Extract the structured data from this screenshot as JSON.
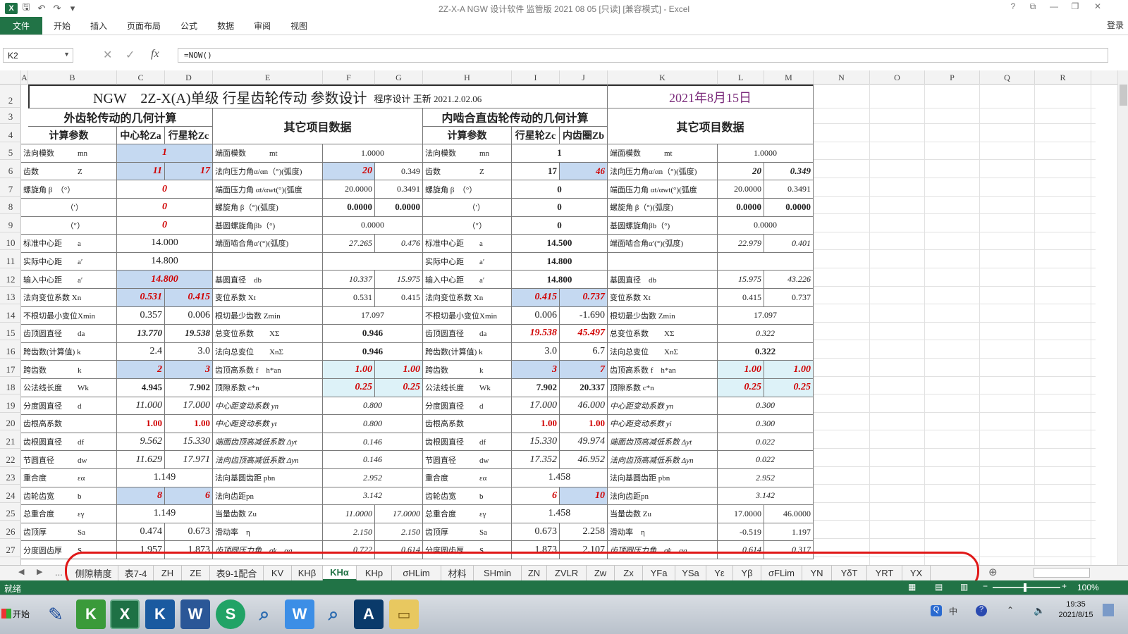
{
  "window": {
    "title": "2Z-X-A NGW 设计软件 监管版 2021 08 05 [只读] [兼容模式] - Excel",
    "help": "?",
    "restore": "⧉",
    "minimize": "—",
    "maximize": "❐",
    "close": "✕"
  },
  "quick_access": {
    "save": "🖫",
    "undo": "↶",
    "redo": "↷",
    "more": "▾"
  },
  "ribbon": {
    "tabs": [
      "文件",
      "开始",
      "插入",
      "页面布局",
      "公式",
      "数据",
      "审阅",
      "视图"
    ],
    "login": "登录"
  },
  "formula_bar": {
    "name_box": "K2",
    "cancel": "✕",
    "enter": "✓",
    "fx": "fx",
    "formula": "=NOW()"
  },
  "columns": [
    "A",
    "B",
    "C",
    "D",
    "E",
    "F",
    "G",
    "H",
    "I",
    "J",
    "K",
    "L",
    "M",
    "N",
    "O",
    "P",
    "Q",
    "R"
  ],
  "rows": [
    "2",
    "3",
    "4",
    "5",
    "6",
    "7",
    "8",
    "9",
    "10",
    "11",
    "12",
    "13",
    "14",
    "15",
    "16",
    "17",
    "18",
    "19",
    "20",
    "21",
    "22",
    "23",
    "24",
    "25",
    "26",
    "27"
  ],
  "sheet": {
    "title": "NGW　2Z-X(A)单级 行星齿轮传动 参数设计",
    "designer": "程序设计 王新 2021.2.02.06",
    "date": "2021年8月15日",
    "left_header": "外齿轮传动的几何计算",
    "mid_header_1": "其它项目数据",
    "right_header": "内啮合直齿轮传动的几何计算",
    "mid_header_2": "其它项目数据",
    "sub": {
      "param": "计算参数",
      "sun": "中心轮Za",
      "planet": "行星轮Zc",
      "param2": "计算参数",
      "planet2": "行星轮Zc",
      "ring": "内齿圈Zb"
    },
    "left_rows": [
      [
        "法向模数　　　mn",
        "1",
        ""
      ],
      [
        "齿数　　　　　Z",
        "11",
        "17"
      ],
      [
        "螺旋角 β　（°）",
        "0",
        ""
      ],
      [
        "　　　　　　（′）",
        "0",
        ""
      ],
      [
        "　　　　　　（″）",
        "0",
        ""
      ],
      [
        "标准中心距　　a",
        "14.000",
        ""
      ],
      [
        "实际中心距　　a′",
        "14.800",
        ""
      ],
      [
        "输入中心距　　a′",
        "14.800",
        ""
      ],
      [
        "法向变位系数 Xn",
        "0.531",
        "0.415"
      ],
      [
        "不根切最小变位Xmin",
        "0.357",
        "0.006"
      ],
      [
        "齿顶圆直径　　da",
        "13.770",
        "19.538"
      ],
      [
        "跨齿数(计算值) k",
        "2.4",
        "3.0"
      ],
      [
        "跨齿数　　　　k",
        "2",
        "3"
      ],
      [
        "公法线长度　　Wk",
        "4.945",
        "7.902"
      ],
      [
        "分度圆直径　　d",
        "11.000",
        "17.000"
      ],
      [
        "齿根高系数",
        "1.00",
        "1.00"
      ],
      [
        "齿根圆直径　　df",
        "9.562",
        "15.330"
      ],
      [
        "节圆直径　　　dw",
        "11.629",
        "17.971"
      ],
      [
        "重合度　　　　εα",
        "1.149",
        ""
      ],
      [
        "齿轮齿宽　　　b",
        "8",
        "6"
      ],
      [
        "总重合度　　　εγ",
        "1.149",
        ""
      ],
      [
        "齿顶厚　　　　Sa",
        "0.474",
        "0.673"
      ],
      [
        "分度圆齿厚　　S",
        "1.957",
        "1.873"
      ]
    ],
    "mid_rows_1": [
      [
        "端面模数　　　mt",
        "1.0000",
        ""
      ],
      [
        "法向压力角α/αn（°)(弧度)",
        "20",
        "0.349"
      ],
      [
        "端面压力角 αt/αwt(°)(弧度",
        "20.0000",
        "0.3491"
      ],
      [
        "螺旋角 β（°)(弧度)",
        "0.0000",
        "0.0000"
      ],
      [
        "基圆螺旋角βb（°)",
        "0.0000",
        ""
      ],
      [
        "端面啮合角α′(°)(弧度)",
        "27.265",
        "0.476"
      ],
      [
        "",
        "",
        ""
      ],
      [
        "基圆直径　db",
        "10.337",
        "15.975"
      ],
      [
        "变位系数 Xt",
        "0.531",
        "0.415"
      ],
      [
        "根切最少齿数 Zmin",
        "17.097",
        ""
      ],
      [
        "总变位系数　　XΣ",
        "0.946",
        ""
      ],
      [
        "法向总变位　　XnΣ",
        "0.946",
        ""
      ],
      [
        "齿顶高系数 f　h*an",
        "1.00",
        "1.00"
      ],
      [
        "顶隙系数 c*n",
        "0.25",
        "0.25"
      ],
      [
        "中心距变动系数 yn",
        "0.800",
        ""
      ],
      [
        "中心距变动系数 yt",
        "0.800",
        ""
      ],
      [
        "端面齿顶高减低系数 Δyt",
        "0.146",
        ""
      ],
      [
        "法向齿顶高减低系数 Δyn",
        "0.146",
        ""
      ],
      [
        "法向基圆齿距 pbn",
        "2.952",
        ""
      ],
      [
        "法向齿距pn",
        "3.142",
        ""
      ],
      [
        "当量齿数 Zu",
        "11.0000",
        "17.0000"
      ],
      [
        "滑动率　η",
        "2.150",
        "2.150"
      ],
      [
        "齿顶圆压力角　σk　αa",
        "0.722",
        "0.614"
      ]
    ],
    "right_rows": [
      [
        "法向模数　　　mn",
        "1",
        ""
      ],
      [
        "齿数　　　　　Z",
        "17",
        "46"
      ],
      [
        "螺旋角 β　（°）",
        "0",
        ""
      ],
      [
        "　　　　　　（′）",
        "0",
        ""
      ],
      [
        "　　　　　　（″）",
        "0",
        ""
      ],
      [
        "标准中心距　　a",
        "14.500",
        ""
      ],
      [
        "实际中心距　　a′",
        "14.800",
        ""
      ],
      [
        "输入中心距　　a′",
        "14.800",
        ""
      ],
      [
        "法向变位系数 Xn",
        "0.415",
        "0.737"
      ],
      [
        "不根切最小变位Xmin",
        "0.006",
        "-1.690"
      ],
      [
        "齿顶圆直径　　da",
        "19.538",
        "45.497"
      ],
      [
        "跨齿数(计算值) k",
        "3.0",
        "6.7"
      ],
      [
        "跨齿数　　　　k",
        "3",
        "7"
      ],
      [
        "公法线长度　　Wk",
        "7.902",
        "20.337"
      ],
      [
        "分度圆直径　　d",
        "17.000",
        "46.000"
      ],
      [
        "齿根高系数",
        "1.00",
        "1.00"
      ],
      [
        "齿根圆直径　　df",
        "15.330",
        "49.974"
      ],
      [
        "节圆直径　　　dw",
        "17.352",
        "46.952"
      ],
      [
        "重合度　　　　εα",
        "1.458",
        ""
      ],
      [
        "齿轮齿宽　　　b",
        "6",
        "10"
      ],
      [
        "总重合度　　　εγ",
        "1.458",
        ""
      ],
      [
        "齿顶厚　　　　Sa",
        "0.673",
        "2.258"
      ],
      [
        "分度圆齿厚　　S",
        "1.873",
        "2.107"
      ]
    ],
    "mid_rows_2": [
      [
        "端面模数　　　mt",
        "1.0000",
        ""
      ],
      [
        "法向压力角α/αn（°)(弧度)",
        "20",
        "0.349"
      ],
      [
        "端面压力角 αt/αwt(°)(弧度",
        "20.0000",
        "0.3491"
      ],
      [
        "螺旋角 β（°)(弧度)",
        "0.0000",
        "0.0000"
      ],
      [
        "基圆螺旋角βb（°)",
        "0.0000",
        ""
      ],
      [
        "端面啮合角α′(°)(弧度)",
        "22.979",
        "0.401"
      ],
      [
        "",
        "",
        ""
      ],
      [
        "基圆直径　db",
        "15.975",
        "43.226"
      ],
      [
        "变位系数 Xt",
        "0.415",
        "0.737"
      ],
      [
        "根切最少齿数 Zmin",
        "17.097",
        ""
      ],
      [
        "总变位系数　　XΣ",
        "0.322",
        ""
      ],
      [
        "法向总变位　　XnΣ",
        "0.322",
        ""
      ],
      [
        "齿顶高系数 f　h*an",
        "1.00",
        "1.00"
      ],
      [
        "顶隙系数 c*n",
        "0.25",
        "0.25"
      ],
      [
        "中心距变动系数 yn",
        "0.300",
        ""
      ],
      [
        "中心距变动系数 yi",
        "0.300",
        ""
      ],
      [
        "端面齿顶高减低系数 Δyt",
        "0.022",
        ""
      ],
      [
        "法向齿顶高减低系数 Δyn",
        "0.022",
        ""
      ],
      [
        "法向基圆齿距 pbn",
        "2.952",
        ""
      ],
      [
        "法向齿距pn",
        "3.142",
        ""
      ],
      [
        "当量齿数 Zu",
        "17.0000",
        "46.0000"
      ],
      [
        "滑动率　η",
        "-0.519",
        "1.197"
      ],
      [
        "齿顶圆压力角　σk　αa",
        "0.614",
        "0.317"
      ]
    ]
  },
  "sheet_tabs": {
    "ellipsis": "...",
    "tabs": [
      "侧隙精度",
      "表7-4",
      "ZH",
      "ZE",
      "表9-1配合",
      "KV",
      "KHβ",
      "KHα",
      "KHp",
      "σHLim",
      "材料",
      "SHmin",
      "ZN",
      "ZVLR",
      "Zw",
      "Zx",
      "YFa",
      "YSa",
      "Yε",
      "Yβ",
      "σFLim",
      "YN",
      "YδT",
      "YRT",
      "YX"
    ],
    "active": "KHα",
    "add": "⊕"
  },
  "status_bar": {
    "ready": "就绪",
    "zoom": "100%",
    "minus": "−",
    "plus": "+"
  },
  "taskbar": {
    "start": "开始",
    "time": "19:35",
    "date": "2021/8/15",
    "apps": [
      "pen-app",
      "K",
      "X",
      "K",
      "W",
      "S",
      "magnifier-app",
      "W",
      "magnifier-app-2",
      "A",
      "folder"
    ]
  }
}
